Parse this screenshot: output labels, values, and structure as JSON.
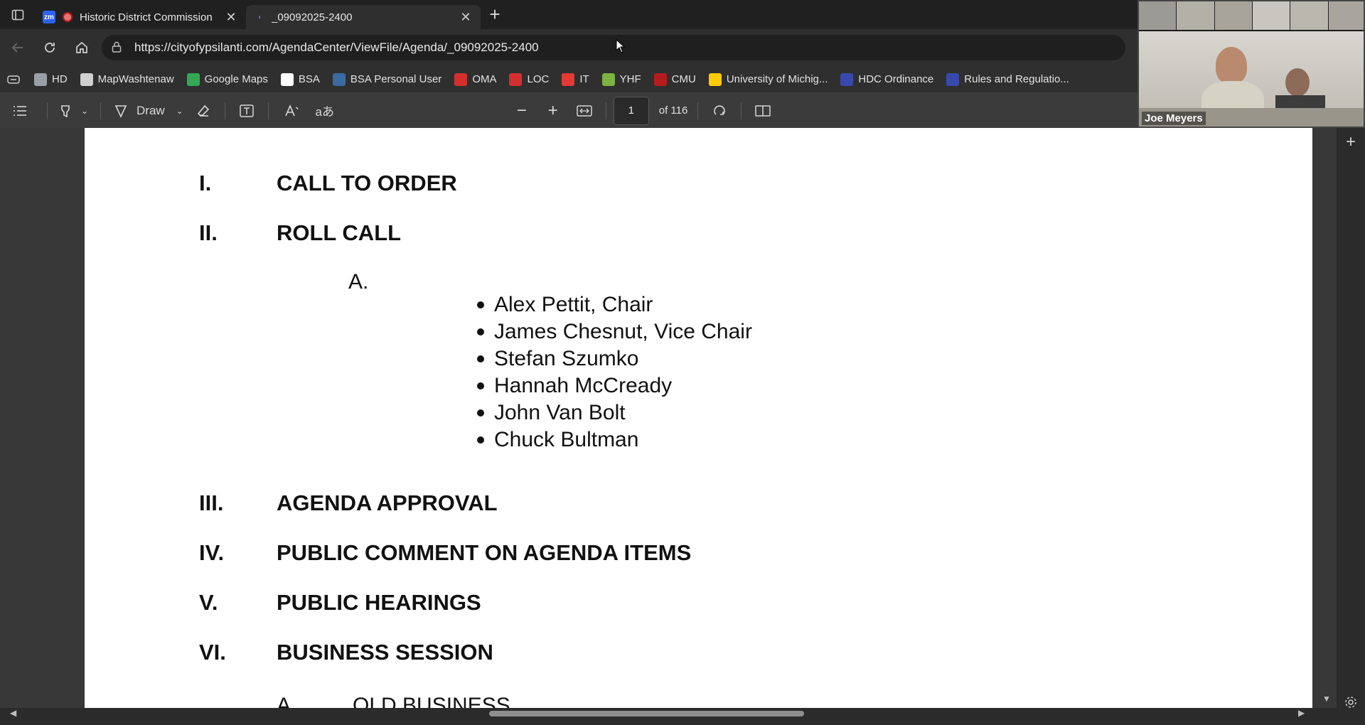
{
  "tabs": [
    {
      "title": "Historic District Commission",
      "active": false,
      "favicon": "zoom-icon",
      "recording": true
    },
    {
      "title": "_09092025-2400",
      "active": true,
      "favicon": "city-icon"
    }
  ],
  "address": {
    "url": "https://cityofypsilanti.com/AgendaCenter/ViewFile/Agenda/_09092025-2400"
  },
  "bookmarks": [
    {
      "label": "HD",
      "icon": "hd-icon",
      "color": "#9aa0a6"
    },
    {
      "label": "MapWashtenaw",
      "icon": "map-icon",
      "color": "#d0d0d0"
    },
    {
      "label": "Google Maps",
      "icon": "google-maps-icon",
      "color": "#34a853"
    },
    {
      "label": "BSA",
      "icon": "bsa-icon",
      "color": "#ffffff"
    },
    {
      "label": "BSA Personal User",
      "icon": "bsa-personal-icon",
      "color": "#3a6aa0"
    },
    {
      "label": "OMA",
      "icon": "pdf-icon",
      "color": "#d32f2f"
    },
    {
      "label": "LOC",
      "icon": "loc-icon",
      "color": "#d32f2f"
    },
    {
      "label": "IT",
      "icon": "it-icon",
      "color": "#e53935"
    },
    {
      "label": "YHF",
      "icon": "yhf-icon",
      "color": "#7cb342"
    },
    {
      "label": "CMU",
      "icon": "cmu-icon",
      "color": "#b71c1c"
    },
    {
      "label": "University of Michig...",
      "icon": "umich-icon",
      "color": "#ffcb05"
    },
    {
      "label": "HDC Ordinance",
      "icon": "city-icon",
      "color": "#3949ab"
    },
    {
      "label": "Rules and Regulatio...",
      "icon": "city-icon",
      "color": "#3949ab"
    }
  ],
  "pdf_toolbar": {
    "draw_label": "Draw",
    "page": "1",
    "page_count": "of 116"
  },
  "document": {
    "sections_top": [
      {
        "num": "I.",
        "title": "CALL TO ORDER"
      },
      {
        "num": "II.",
        "title": "ROLL CALL"
      }
    ],
    "sub_label": "A.",
    "roll_call": [
      "Alex Pettit, Chair",
      "James Chesnut, Vice Chair",
      "Stefan Szumko",
      "Hannah McCready",
      "John Van Bolt",
      "Chuck Bultman"
    ],
    "sections_bottom": [
      {
        "num": "III.",
        "title": "AGENDA APPROVAL"
      },
      {
        "num": "IV.",
        "title": "PUBLIC COMMENT ON AGENDA ITEMS"
      },
      {
        "num": "V.",
        "title": "PUBLIC HEARINGS"
      },
      {
        "num": "VI.",
        "title": "BUSINESS SESSION"
      }
    ],
    "cut_off": {
      "num": "A.",
      "title": "OLD BUSINESS"
    }
  },
  "video": {
    "speaker_name": "Joe Meyers"
  }
}
